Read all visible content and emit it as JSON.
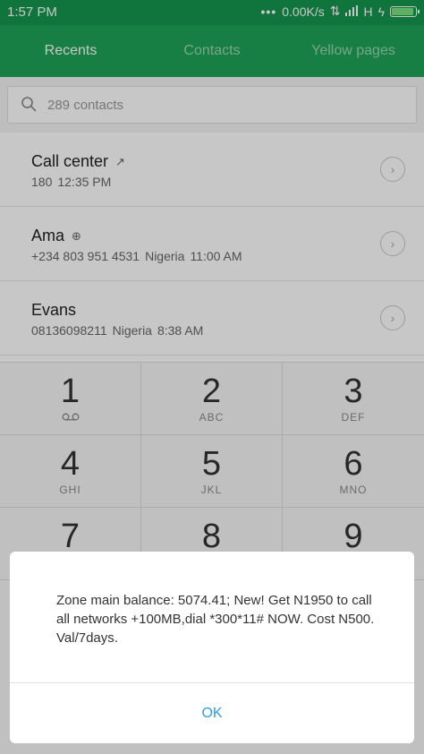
{
  "status_bar": {
    "time": "1:57 PM",
    "dots": "•••",
    "speed": "0.00K/s",
    "network": "H",
    "battery_level": 0.92
  },
  "tabs": [
    {
      "label": "Recents",
      "active": true
    },
    {
      "label": "Contacts",
      "active": false
    },
    {
      "label": "Yellow pages",
      "active": false
    }
  ],
  "search": {
    "placeholder": "289 contacts"
  },
  "recents": [
    {
      "name": "Call center",
      "icon": "outgoing-arrow-icon",
      "glyph": "↗",
      "number": "180",
      "location": "",
      "time": "12:35 PM"
    },
    {
      "name": "Ama",
      "icon": "add-contact-icon",
      "glyph": "⊕",
      "number": "+234 803 951 4531",
      "location": "Nigeria",
      "time": "11:00 AM"
    },
    {
      "name": "Evans",
      "icon": "",
      "glyph": "",
      "number": "08136098211",
      "location": "Nigeria",
      "time": "8:38 AM"
    }
  ],
  "dialpad": [
    {
      "digit": "1",
      "letters": ""
    },
    {
      "digit": "2",
      "letters": "ABC"
    },
    {
      "digit": "3",
      "letters": "DEF"
    },
    {
      "digit": "4",
      "letters": "GHI"
    },
    {
      "digit": "5",
      "letters": "JKL"
    },
    {
      "digit": "6",
      "letters": "MNO"
    },
    {
      "digit": "7",
      "letters": ""
    },
    {
      "digit": "8",
      "letters": ""
    },
    {
      "digit": "9",
      "letters": ""
    }
  ],
  "dialog": {
    "message": "Zone main balance: 5074.41; New! Get N1950 to call all networks +100MB,dial *300*11# NOW. Cost N500. Val/7days.",
    "ok_label": "OK"
  },
  "colors": {
    "status_bar": "#15964d",
    "tab_bar": "#1ea356",
    "dialog_button": "#2a9df0"
  }
}
